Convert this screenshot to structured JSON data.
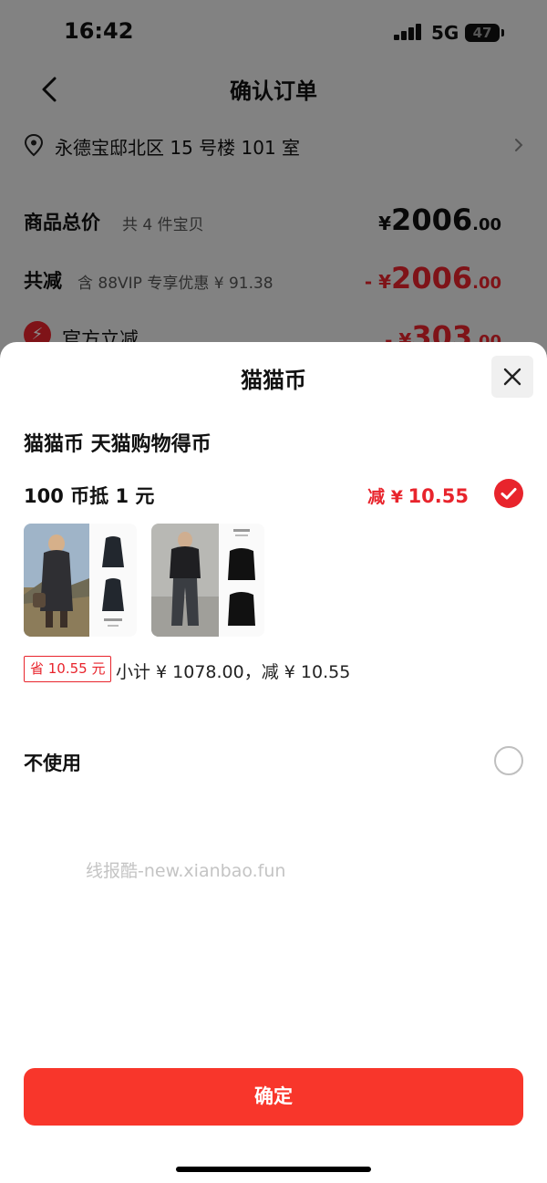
{
  "status_bar": {
    "time": "16:42",
    "network": "5G",
    "battery": "47"
  },
  "order_page": {
    "nav_title": "确认订单",
    "address": "永德宝邸北区 15 号楼 101 室",
    "total": {
      "label": "商品总价",
      "sub": "共 4 件宝贝",
      "yen": "¥",
      "amount_int": "2006",
      "amount_dec": ".00"
    },
    "reduction": {
      "label": "共减",
      "sub": "含 88VIP 专享优惠 ¥ 91.38",
      "prefix": "- ¥",
      "amount_int": "2006",
      "amount_dec": ".00"
    },
    "official": {
      "label": "官方立减",
      "prefix": "- ¥",
      "amount_int": "303",
      "amount_dec": ".00",
      "icon": "lightning-icon"
    }
  },
  "sheet": {
    "title": "猫猫币",
    "coin_heading": "猫猫币 天猫购物得币",
    "rule_label": "100 币抵 1 元",
    "discount_prefix": "减 ¥",
    "discount_value": "10.55",
    "products": [
      {
        "name": "product-thumb-long-down-coat"
      },
      {
        "name": "product-thumb-short-jacket"
      }
    ],
    "save_tag": "省 10.55 元",
    "subtotal": "小计 ¥ 1078.00，减 ¥ 10.55",
    "no_use_label": "不使用",
    "watermark": "线报酷-new.xianbao.fun",
    "confirm_label": "确定"
  },
  "colors": {
    "accent": "#e8242c",
    "button": "#f8362b",
    "overlay": "rgba(0,0,0,0.45)"
  }
}
